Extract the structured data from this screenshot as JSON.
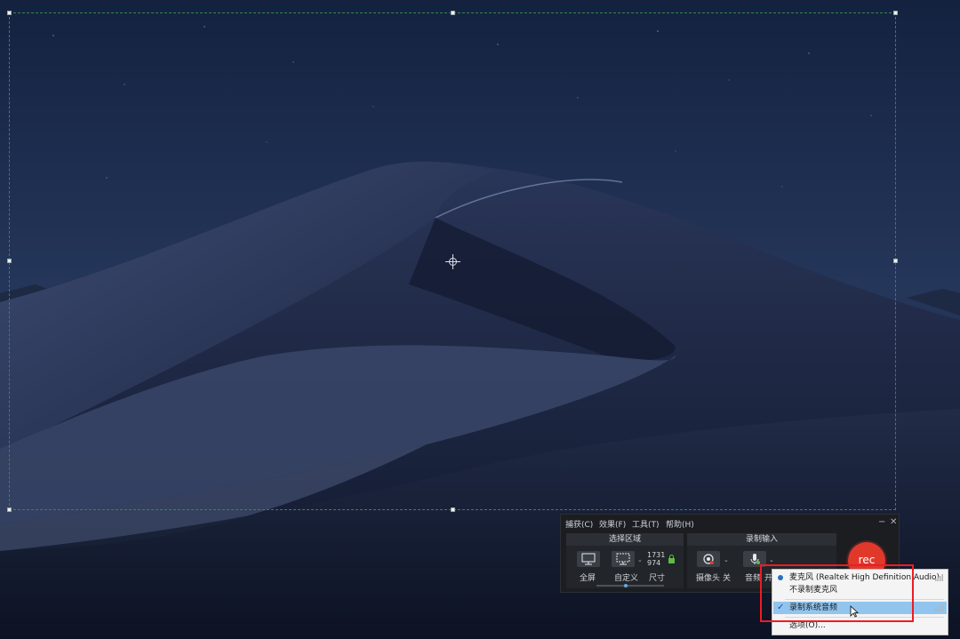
{
  "wallpaper": {
    "name": "night desert dunes",
    "sky_color": "#1d2d4e",
    "dune_color": "#2a3450"
  },
  "selection": {
    "border_color": "#2f8a49"
  },
  "recorder": {
    "menu": [
      "捕获(C)",
      "效果(F)",
      "工具(T)",
      "帮助(H)"
    ],
    "window_buttons": {
      "minimize": "−",
      "close": "✕"
    },
    "select_area": {
      "header": "选择区域",
      "fullscreen_label": "全屏",
      "custom_label": "自定义",
      "size_label": "尺寸",
      "width_value": "1731",
      "height_value": "974"
    },
    "record_input": {
      "header": "录制输入",
      "camera_label": "摄像头",
      "camera_state": "关",
      "audio_label": "音频",
      "audio_state": "开"
    },
    "rec_button": "rec",
    "accent_color": "#e0392c"
  },
  "audio_menu": {
    "items": [
      {
        "label": "麦克风 (Realtek High Definition Audio)",
        "mark": "radio"
      },
      {
        "label": "不录制麦克风",
        "mark": "none"
      },
      {
        "label": "录制系统音频",
        "mark": "check",
        "highlighted": true
      },
      {
        "label": "选项(O)...",
        "mark": "none"
      }
    ],
    "highlight_color": "#91c5ee",
    "annotation_color": "#ee1c24"
  }
}
